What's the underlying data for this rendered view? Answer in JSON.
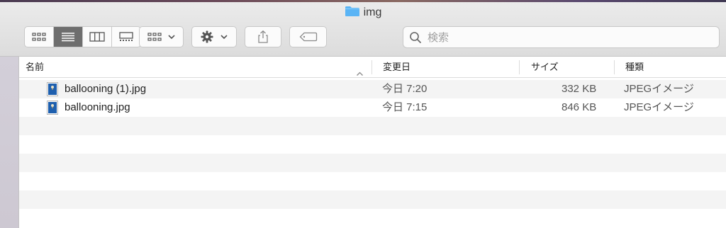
{
  "window": {
    "title": "img"
  },
  "toolbar": {
    "view_buttons": [
      "icon-view",
      "list-view",
      "column-view",
      "gallery-view"
    ],
    "active_view": "list-view",
    "search": {
      "placeholder": "検索",
      "value": ""
    }
  },
  "table": {
    "columns": {
      "name": "名前",
      "date": "変更日",
      "size": "サイズ",
      "kind": "種類"
    },
    "rows": [
      {
        "name": "ballooning (1).jpg",
        "date": "今日 7:20",
        "size": "332 KB",
        "kind": "JPEGイメージ"
      },
      {
        "name": "ballooning.jpg",
        "date": "今日 7:15",
        "size": "846 KB",
        "kind": "JPEGイメージ"
      }
    ]
  },
  "colors": {
    "folder": "#5ab4f5",
    "active_segment": "#6e6e6e",
    "row_alt": "#f4f4f4"
  }
}
